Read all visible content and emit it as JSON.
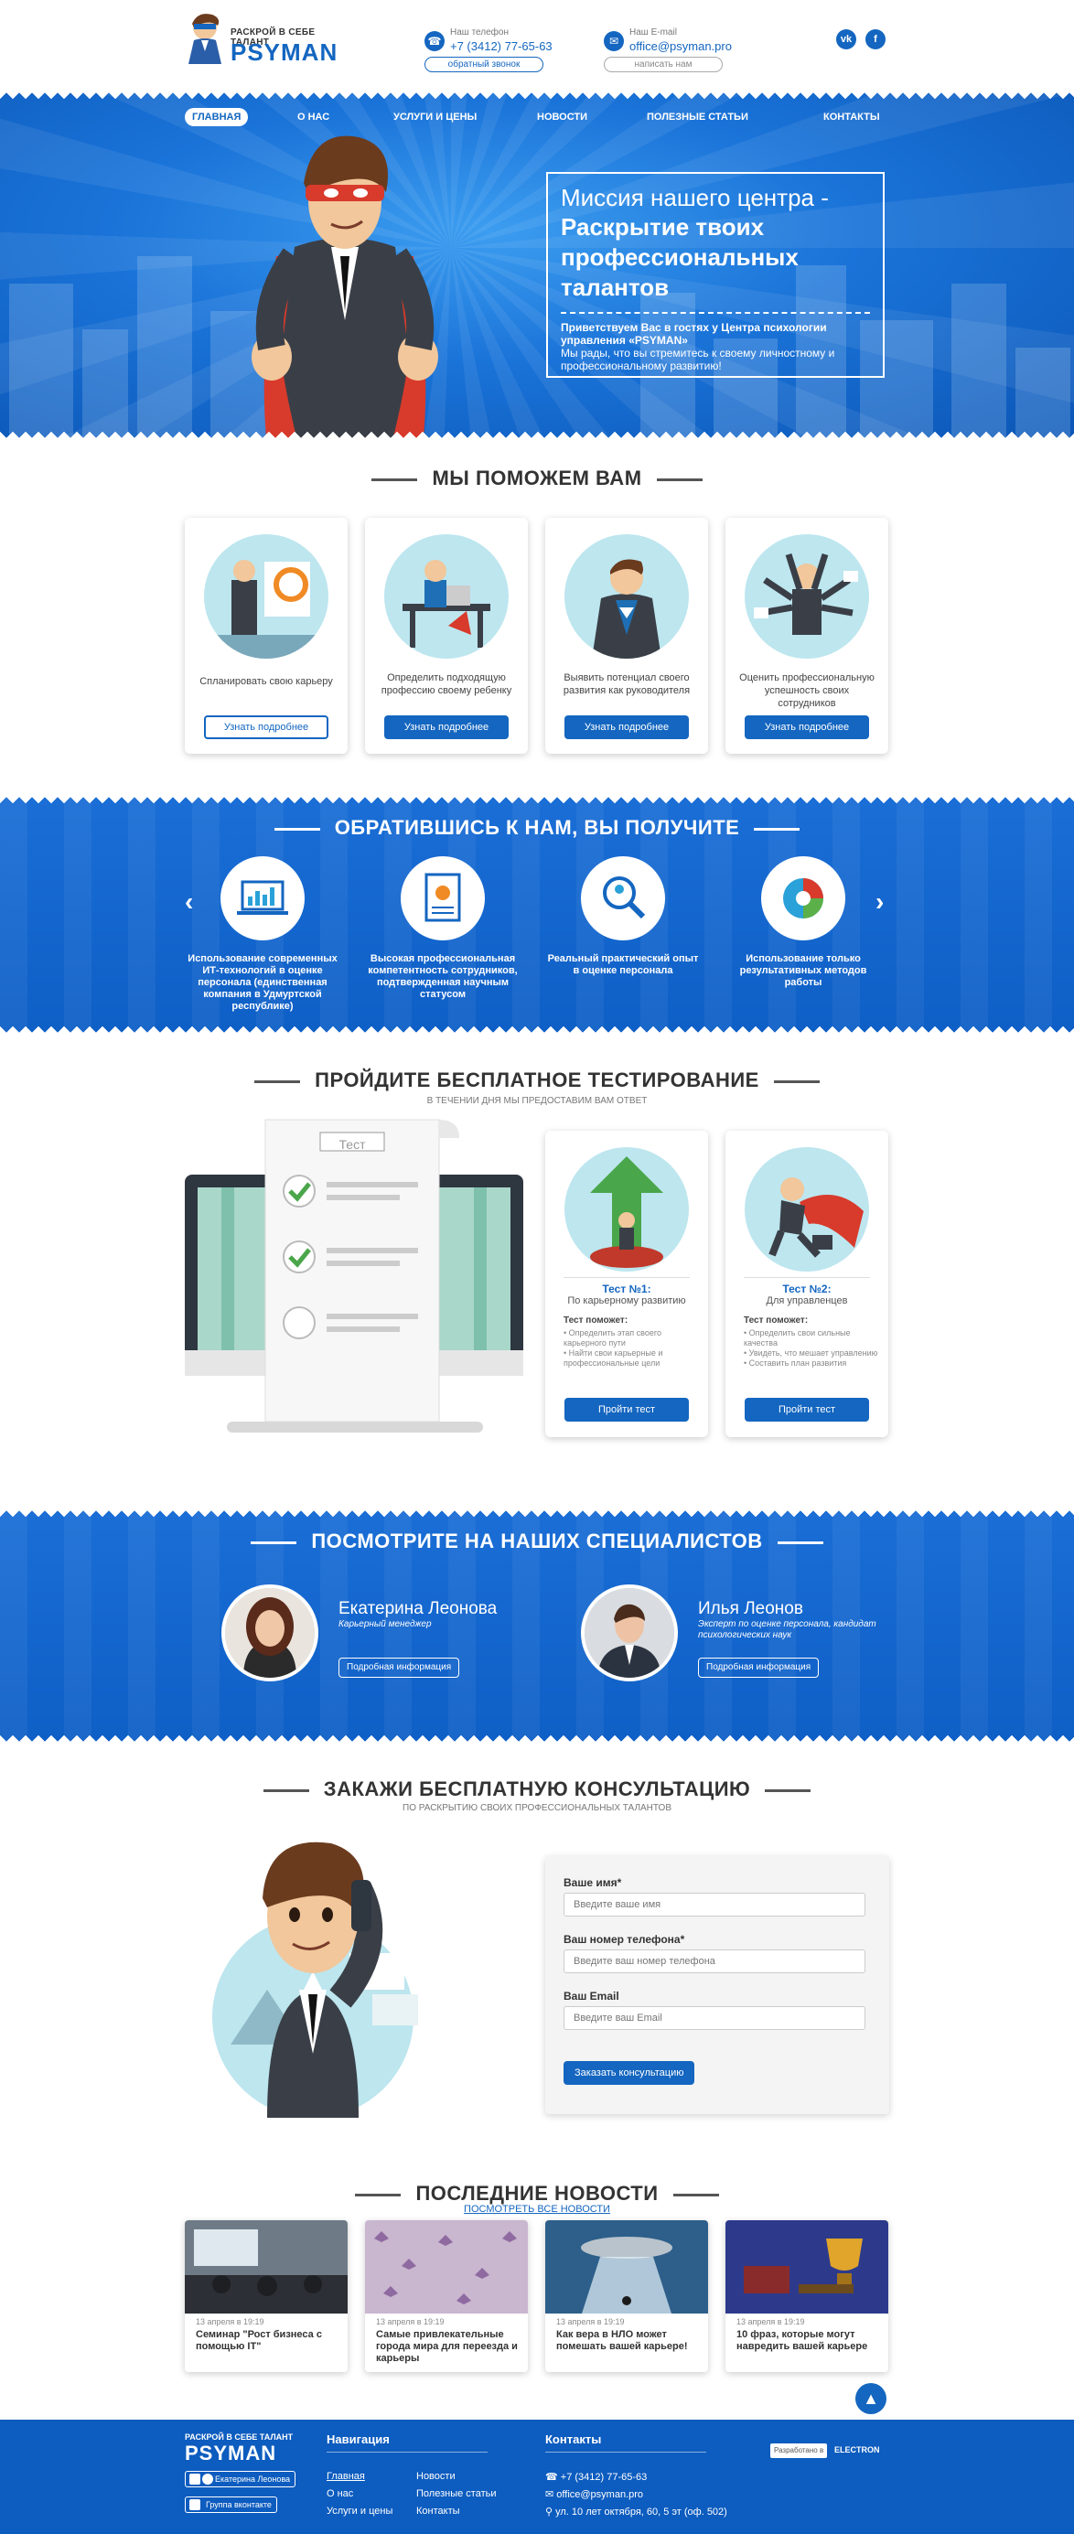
{
  "header": {
    "logo_tagline": "РАСКРОЙ В СЕБЕ ТАЛАНТ",
    "logo_name": "PSYMAN",
    "phone_label": "Наш телефон",
    "phone_value": "+7 (3412) 77-65-63",
    "callback_button": "обратный звонок",
    "email_label": "Наш E-mail",
    "email_value": "office@psyman.pro",
    "write_button": "написать нам",
    "social_vk": "vk",
    "social_fb": "f"
  },
  "nav": [
    "ГЛАВНАЯ",
    "О НАС",
    "УСЛУГИ И ЦЕНЫ",
    "НОВОСТИ",
    "ПОЛЕЗНЫЕ СТАТЬИ",
    "КОНТАКТЫ"
  ],
  "hero": {
    "line1": "Миссия нашего центра -",
    "line2": "Раскрытие твоих профессиональных талантов",
    "welcome": "Приветствуем Вас в гостях у Центра психологии управления «PSYMAN»",
    "welcome2": "Мы рады, что вы стремитесь к своему личностному и профессиональному развитию!"
  },
  "help": {
    "title": "МЫ ПОМОЖЕМ ВАМ",
    "cards": [
      {
        "text": "Спланировать свою карьеру",
        "button": "Узнать подробнее"
      },
      {
        "text": "Определить подходящую профессию своему ребенку",
        "button": "Узнать подробнее"
      },
      {
        "text": "Выявить потенциал своего развития как руководителя",
        "button": "Узнать подробнее"
      },
      {
        "text": "Оценить профессиональную успешность своих сотрудников",
        "button": "Узнать подробнее"
      }
    ]
  },
  "benefits": {
    "title": "ОБРАТИВШИСЬ К НАМ, ВЫ ПОЛУЧИТЕ",
    "items": [
      "Использование современных ИТ-технологий в оценке персонала (единственная компания в Удмуртской республике)",
      "Высокая профессиональная компетентность сотрудников, подтвержденная научным статусом",
      "Реальный практический опыт в оценке персонала",
      "Использование только результативных методов работы"
    ]
  },
  "testing": {
    "title": "ПРОЙДИТЕ БЕСПЛАТНОЕ ТЕСТИРОВАНИЕ",
    "subtitle": "В ТЕЧЕНИИ ДНЯ МЫ ПРЕДОСТАВИМ ВАМ ОТВЕТ",
    "paper_label": "Тест",
    "tests": [
      {
        "title": "Тест №1:",
        "subtitle": "По карьерному развитию",
        "helps": "Тест поможет:",
        "points": [
          "• Определить этап своего карьерного пути",
          "• Найти свои карьерные и профессиональные цели"
        ],
        "button": "Пройти тест"
      },
      {
        "title": "Тест №2:",
        "subtitle": "Для управленцев",
        "helps": "Тест поможет:",
        "points": [
          "• Определить свои сильные качества",
          "• Увидеть, что мешает управлению",
          "• Составить план развития"
        ],
        "button": "Пройти тест"
      }
    ]
  },
  "specialists": {
    "title": "ПОСМОТРИТЕ НА НАШИХ СПЕЦИАЛИСТОВ",
    "people": [
      {
        "name": "Екатерина Леонова",
        "role": "Карьерный менеджер",
        "button": "Подробная информация"
      },
      {
        "name": "Илья Леонов",
        "role": "Эксперт по оценке персонала, кандидат психологических наук",
        "button": "Подробная информация"
      }
    ]
  },
  "consult": {
    "title": "ЗАКАЖИ БЕСПЛАТНУЮ КОНСУЛЬТАЦИЮ",
    "subtitle": "ПО РАСКРЫТИЮ СВОИХ ПРОФЕССИОНАЛЬНЫХ ТАЛАНТОВ",
    "name_label": "Ваше имя*",
    "name_placeholder": "Введите ваше имя",
    "phone_label": "Ваш номер телефона*",
    "phone_placeholder": "Введите ваш номер телефона",
    "email_label": "Ваш Email",
    "email_placeholder": "Введите ваш Email",
    "button": "Заказать консультацию"
  },
  "news": {
    "title": "ПОСЛЕДНИЕ НОВОСТИ",
    "all_link": "ПОСМОТРЕТЬ ВСЕ НОВОСТИ",
    "items": [
      {
        "date": "13 апреля в 19:19",
        "title": "Семинар \"Рост бизнеса с помощью IT\""
      },
      {
        "date": "13 апреля в 19:19",
        "title": "Самые привлекательные города мира для переезда и карьеры"
      },
      {
        "date": "13 апреля в 19:19",
        "title": "Как вера в НЛО может помешать вашей карьере!"
      },
      {
        "date": "13 апреля в 19:19",
        "title": "10 фраз, которые могут навредить вашей карьере"
      }
    ]
  },
  "footer": {
    "logo_tagline": "РАСКРОЙ В СЕБЕ ТАЛАНТ",
    "logo_name": "PSYMAN",
    "social1": "Екатерина Леонова",
    "social2": "Группа вконтакте",
    "nav_title": "Навигация",
    "nav_links": [
      "Главная",
      "Новости",
      "О нас",
      "Полезные статьи",
      "Услуги и цены",
      "Контакты"
    ],
    "contacts_title": "Контакты",
    "phone": "+7 (3412) 77-65-63",
    "email": "office@psyman.pro",
    "address": "ул. 10 лет октября, 60, 5 эт (оф. 502)",
    "dev_label": "Разработано в",
    "dev_name": "ELECTRON"
  },
  "colors": {
    "brand_blue": "#1466c0",
    "band_blue": "#1a6ed6"
  }
}
